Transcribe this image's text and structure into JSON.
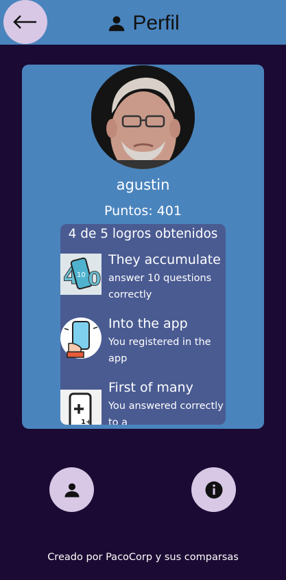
{
  "header": {
    "title": "Perfil",
    "back_icon": "arrow-left-icon",
    "title_icon": "person-icon",
    "bar_color": "#4a84bd"
  },
  "profile": {
    "username": "agustin",
    "points_label": "Puntos: 401",
    "avatar_icon": "user-photo"
  },
  "achievements": {
    "summary": "4 de 5 logros obtenidos",
    "items": [
      {
        "title": "They accumulate",
        "description": "answer 10 questions correctly",
        "icon": "phone-10-icon"
      },
      {
        "title": "Into the app",
        "description": "You registered in the app",
        "icon": "hand-phone-icon"
      },
      {
        "title": "First of many",
        "description": "You answered correctly to a",
        "icon": "phone-plus-one-icon"
      }
    ]
  },
  "bottom_nav": {
    "profile_icon": "person-icon",
    "info_icon": "info-icon"
  },
  "footer": {
    "text": "Creado por PacoCorp y sus comparsas"
  },
  "colors": {
    "background": "#1b0a33",
    "card": "#4a84bd",
    "achievements_panel": "#4a5b92",
    "button": "#d8c8e6"
  }
}
